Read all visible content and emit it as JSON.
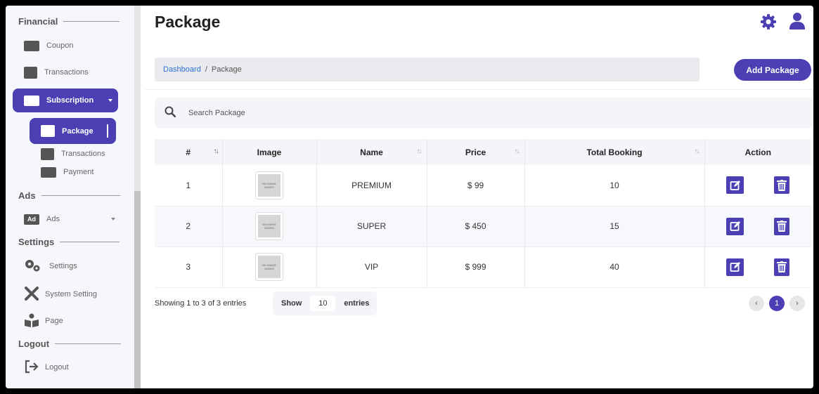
{
  "sidebar": {
    "sections": {
      "financial": "Financial",
      "ads": "Ads",
      "settings": "Settings",
      "logout": "Logout"
    },
    "items": {
      "coupon": "Coupon",
      "transactions": "Transactions",
      "subscription": "Subscription",
      "package": "Package",
      "sub_transactions": "Transactions",
      "payment": "Payment",
      "ads": "Ads",
      "settings": "Settings",
      "system_setting": "System Setting",
      "page": "Page",
      "logout": "Logout"
    },
    "ads_badge": "Ad"
  },
  "header": {
    "title": "Package",
    "icons": [
      "gear-icon",
      "user-icon"
    ],
    "accent_color": "#4b3fb3"
  },
  "breadcrumb": {
    "home": "Dashboard",
    "separator": "/",
    "current": "Package"
  },
  "add_button": "Add Package",
  "search": {
    "placeholder": "Search Package"
  },
  "table": {
    "columns": [
      "#",
      "Image",
      "Name",
      "Price",
      "Total Booking",
      "Action"
    ],
    "rows": [
      {
        "num": "1",
        "image_text": "NO IMAGE ADDED",
        "name": "PREMIUM",
        "price": "$ 99",
        "total_booking": "10"
      },
      {
        "num": "2",
        "image_text": "NO IMAGE ADDED",
        "name": "SUPER",
        "price": "$ 450",
        "total_booking": "15"
      },
      {
        "num": "3",
        "image_text": "NO IMAGE ADDED",
        "name": "VIP",
        "price": "$ 999",
        "total_booking": "40"
      }
    ]
  },
  "footer": {
    "showing": "Showing 1 to 3 of 3 entries",
    "show_label": "Show",
    "page_length": "10",
    "entries_label": "entries",
    "prev": "‹",
    "current_page": "1",
    "next": "›"
  }
}
